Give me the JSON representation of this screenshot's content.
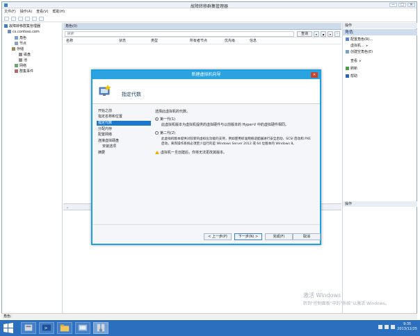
{
  "window": {
    "title": "故障转移群集管理器",
    "min": "—",
    "max": "□",
    "close": "✕"
  },
  "menu": [
    "文件(F)",
    "操作(A)",
    "查看(V)",
    "帮助(H)"
  ],
  "tree": {
    "root": "故障转移群集管理器",
    "cluster": "cs.contoso.com",
    "items": [
      "角色",
      "节点",
      "存储",
      "磁盘",
      "池",
      "网络",
      "群集事件"
    ]
  },
  "center": {
    "header": "角色(0)",
    "search_placeholder": "搜索",
    "query_label": "查询",
    "columns": [
      "名称",
      "状态",
      "类型",
      "所有者节点",
      "优先级",
      "信息"
    ]
  },
  "actions": {
    "header": "操作",
    "group": "角色",
    "items": [
      "配置角色(R)...",
      "虚拟机...",
      "创建空角色(E)",
      "查看",
      "刷新",
      "帮助"
    ],
    "bottom_header": "操作"
  },
  "dialog": {
    "title": "新建虚拟机向导",
    "close": "✕",
    "header_title": "指定代数",
    "steps": [
      "开始之前",
      "指定名称和位置",
      "指定代数",
      "分配内存",
      "配置网络",
      "连接虚拟硬盘",
      "安装选项",
      "摘要"
    ],
    "active_step": 2,
    "prompt": "选择此虚拟机的代数。",
    "gen1_label": "第一代(1)",
    "gen1_desc": "此虚拟机版本为虚拟机提供的虚拟硬件与以前版本的 Hyper-V 中的虚拟硬件相同。",
    "gen2_label": "第二代(2)",
    "gen2_desc1": "此虚拟机版本提供对较新的虚拟化功能的支持，例如使用标准网络适配器进行安全启动、SCSI 启动和 PXE",
    "gen2_desc2": "启动，来宾操作系统必须至少运行的是 Windows Server 2012 或 64 位版本的 Windows 8。",
    "warning": "虚拟机一旦创建后，你将无法更改其版本。",
    "buttons": {
      "prev": "< 上一步(P)",
      "next": "下一步(N) >",
      "finish": "完成(F)",
      "cancel": "取消"
    }
  },
  "watermark": {
    "line1": "激活 Windows",
    "line2": "转到\"控制面板\"中的\"系统\"以激活 Windows。"
  },
  "statusbar": "角色: ",
  "taskbar": {
    "time": "9:35",
    "date": "2013/12/25"
  },
  "colors": {
    "accent": "#2aa3e0",
    "taskbar": "#2c6fbf",
    "selected_step": "#1a77cc"
  }
}
